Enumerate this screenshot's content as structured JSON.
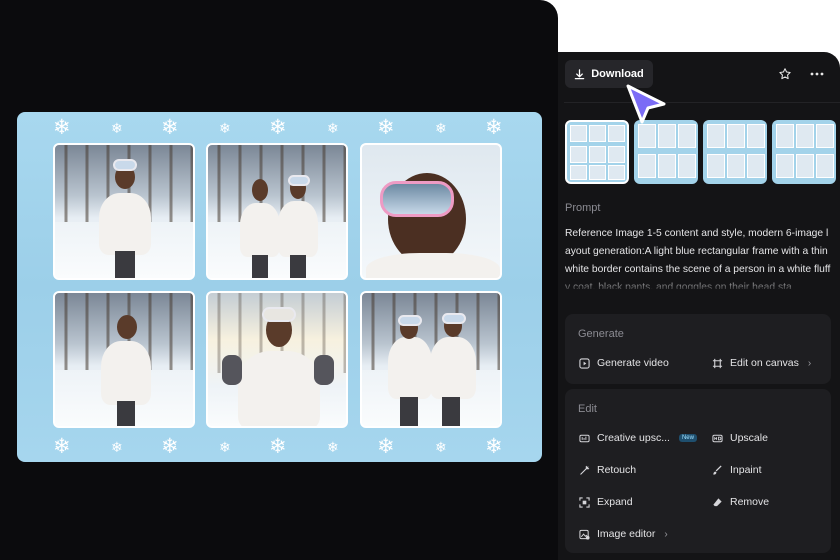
{
  "toolbar": {
    "download_label": "Download",
    "download_icon": "download-icon",
    "favorite_icon": "star-icon",
    "more_icon": "more-horizontal-icon"
  },
  "thumbnails": [
    {
      "label": "variant-1",
      "selected": true
    },
    {
      "label": "variant-2",
      "selected": false
    },
    {
      "label": "variant-3",
      "selected": false
    },
    {
      "label": "variant-4",
      "selected": false
    }
  ],
  "prompt": {
    "heading": "Prompt",
    "text": "Reference Image 1-5 content and style, modern 6-image layout generation:A light blue rectangular frame with a thin white border contains the scene of a person in a white fluffy coat, black pants, and goggles on their head sta"
  },
  "generate": {
    "heading": "Generate",
    "items": [
      {
        "label": "Generate video",
        "icon": "play-icon"
      },
      {
        "label": "Edit on canvas",
        "icon": "canvas-icon",
        "chevron": "›"
      }
    ]
  },
  "edit": {
    "heading": "Edit",
    "items": [
      {
        "label": "Creative upsc...",
        "icon": "upscale-creative-icon",
        "badge": "New"
      },
      {
        "label": "Upscale",
        "icon": "hd-icon"
      },
      {
        "label": "Retouch",
        "icon": "magic-wand-icon"
      },
      {
        "label": "Inpaint",
        "icon": "brush-icon"
      },
      {
        "label": "Expand",
        "icon": "expand-icon"
      },
      {
        "label": "Remove",
        "icon": "eraser-icon"
      },
      {
        "label": "Image editor",
        "icon": "image-edit-icon",
        "chevron": "›"
      }
    ]
  },
  "colors": {
    "stage": "#0b0b0d",
    "panel": "#141416",
    "card": "#1e1e21",
    "frame": "#a3d3ea",
    "cursor": "#7b6cf6"
  }
}
